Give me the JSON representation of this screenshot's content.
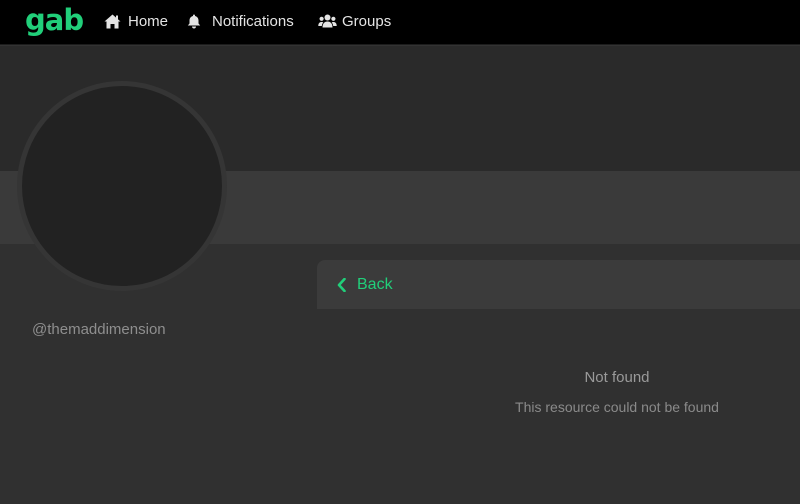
{
  "brand": {
    "logo_text": "gab",
    "accent_color": "#21cf7a"
  },
  "nav": {
    "items": [
      {
        "label": "Home",
        "icon": "home-icon"
      },
      {
        "label": "Notifications",
        "icon": "bell-icon"
      },
      {
        "label": "Groups",
        "icon": "users-icon"
      }
    ]
  },
  "profile": {
    "username": "@themaddimension"
  },
  "content": {
    "back_label": "Back",
    "back_icon": "chevron-left-icon",
    "error_title": "Not found",
    "error_message": "This resource could not be found"
  }
}
